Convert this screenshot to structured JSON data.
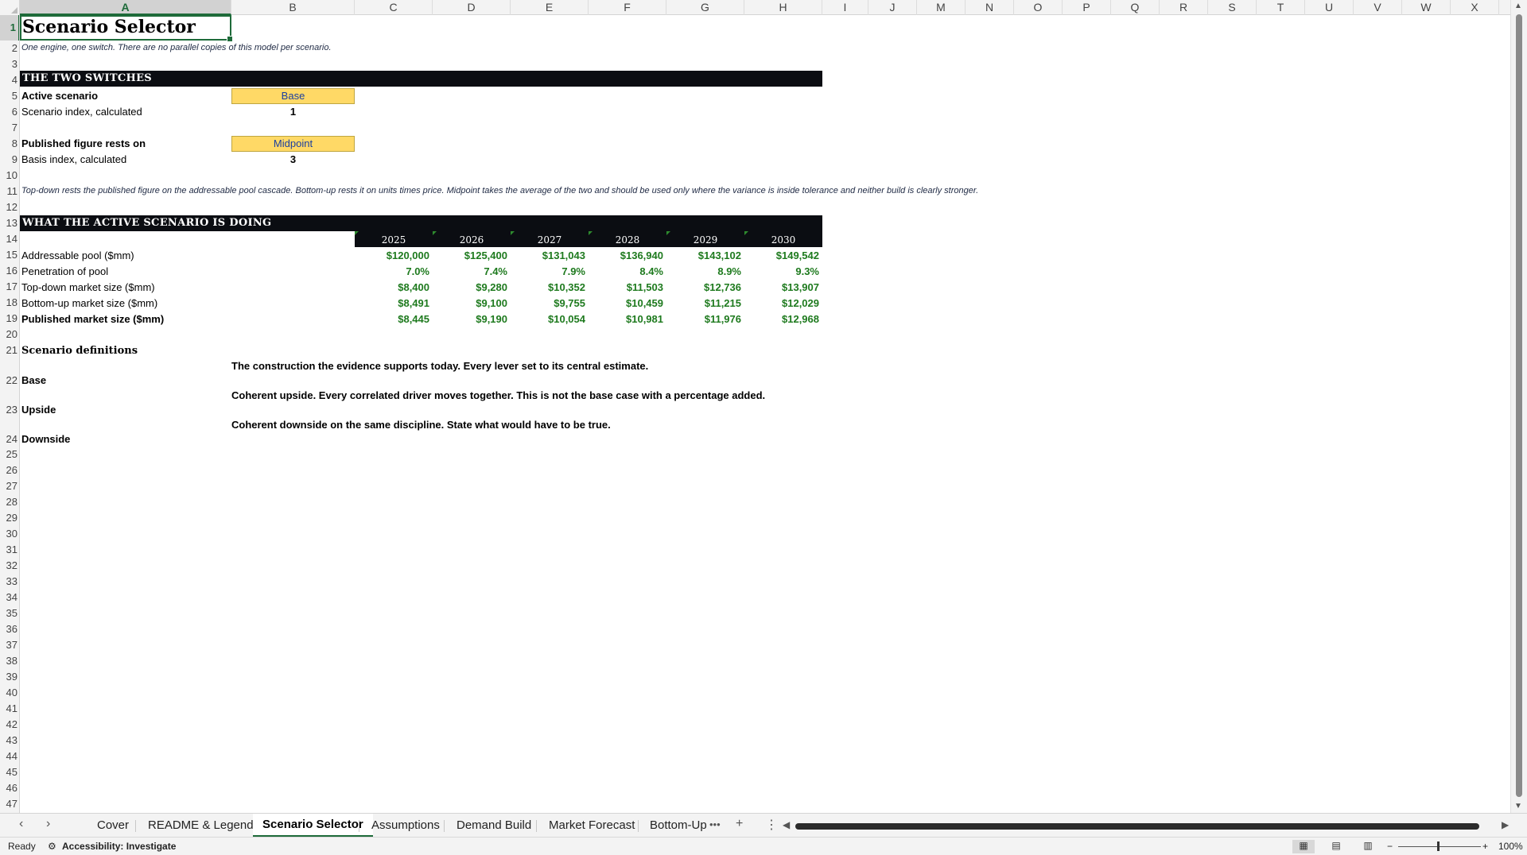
{
  "columns": [
    "A",
    "B",
    "C",
    "D",
    "E",
    "F",
    "G",
    "H",
    "I",
    "J",
    "M",
    "N",
    "O",
    "P",
    "Q",
    "R",
    "S",
    "T",
    "U",
    "V",
    "W",
    "X"
  ],
  "rows": [
    "1",
    "2",
    "3",
    "4",
    "5",
    "6",
    "7",
    "8",
    "9",
    "10",
    "11",
    "12",
    "13",
    "14",
    "15",
    "16",
    "17",
    "18",
    "19",
    "20",
    "21",
    "22",
    "23",
    "24",
    "25",
    "26",
    "27",
    "28",
    "29",
    "30",
    "31",
    "32",
    "33",
    "34",
    "35",
    "36",
    "37",
    "38",
    "39",
    "40",
    "41",
    "42",
    "43",
    "44",
    "45",
    "46",
    "47"
  ],
  "sheet": {
    "title": "Scenario Selector",
    "subtitle": "One engine, one switch. There are no parallel copies of this model per scenario.",
    "section1": "THE TWO SWITCHES",
    "active_scenario_label": "Active scenario",
    "active_scenario_value": "Base",
    "scenario_index_label": "Scenario index, calculated",
    "scenario_index_value": "1",
    "published_basis_label": "Published figure rests on",
    "published_basis_value": "Midpoint",
    "basis_index_label": "Basis index, calculated",
    "basis_index_value": "3",
    "note": "Top-down rests the published figure on the addressable pool cascade. Bottom-up rests it on units times price. Midpoint takes the average of the two and should be used only where the variance is inside tolerance and neither build is clearly stronger.",
    "section2": "WHAT THE ACTIVE SCENARIO IS DOING",
    "years": [
      "2025",
      "2026",
      "2027",
      "2028",
      "2029",
      "2030"
    ],
    "table": [
      {
        "label": "Addressable pool ($mm)",
        "bold": false,
        "values": [
          "$120,000",
          "$125,400",
          "$131,043",
          "$136,940",
          "$143,102",
          "$149,542"
        ]
      },
      {
        "label": "Penetration of pool",
        "bold": false,
        "values": [
          "7.0%",
          "7.4%",
          "7.9%",
          "8.4%",
          "8.9%",
          "9.3%"
        ]
      },
      {
        "label": "Top-down market size ($mm)",
        "bold": false,
        "values": [
          "$8,400",
          "$9,280",
          "$10,352",
          "$11,503",
          "$12,736",
          "$13,907"
        ]
      },
      {
        "label": "Bottom-up market size ($mm)",
        "bold": false,
        "values": [
          "$8,491",
          "$9,100",
          "$9,755",
          "$10,459",
          "$11,215",
          "$12,029"
        ]
      },
      {
        "label": "Published market size ($mm)",
        "bold": true,
        "values": [
          "$8,445",
          "$9,190",
          "$10,054",
          "$10,981",
          "$11,976",
          "$12,968"
        ]
      }
    ],
    "definitions_heading": "Scenario definitions",
    "definitions": [
      {
        "name": "Base",
        "text": "The construction the evidence supports today. Every lever set to its central estimate."
      },
      {
        "name": "Upside",
        "text": "Coherent upside. Every correlated driver moves together. This is not the base case with a percentage added."
      },
      {
        "name": "Downside",
        "text": "Coherent downside on the same discipline. State what would have to be true."
      }
    ]
  },
  "tabs": [
    "Cover",
    "README & Legend",
    "Scenario Selector",
    "Assumptions",
    "Demand Build",
    "Market Forecast",
    "Bottom-Up"
  ],
  "active_tab": "Scenario Selector",
  "tab_more": "•••",
  "tab_add": "+",
  "tab_options": "⋮",
  "status": {
    "ready": "Ready",
    "accessibility": "Accessibility: Investigate",
    "zoom": "100%"
  },
  "colors": {
    "band": "#0b0d12",
    "switch_fill": "#ffd966",
    "input_text": "#1a3fa0",
    "output_green": "#1e7a1e",
    "selection": "#1e6b3a"
  }
}
